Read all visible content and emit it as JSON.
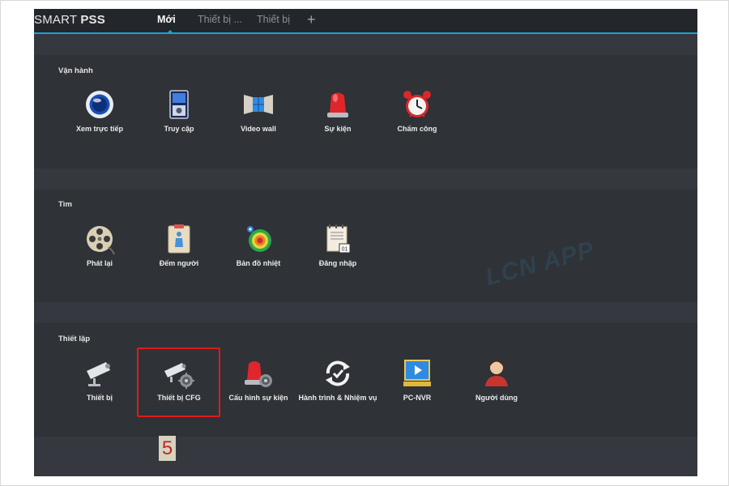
{
  "app": {
    "logo_prefix": "SMART ",
    "logo_bold": "PSS"
  },
  "tabs": [
    {
      "label": "Mới",
      "active": true
    },
    {
      "label": "Thiết bị ..."
    },
    {
      "label": "Thiết bị"
    }
  ],
  "add_tab_symbol": "+",
  "accent_color": "#17a3d8",
  "sections": {
    "operation": {
      "title": "Vận hành",
      "items": [
        {
          "label": "Xem trực tiếp",
          "icon": "live-view-icon"
        },
        {
          "label": "Truy cập",
          "icon": "access-control-icon"
        },
        {
          "label": "Video wall",
          "icon": "video-wall-icon"
        },
        {
          "label": "Sự kiện",
          "icon": "alarm-siren-icon"
        },
        {
          "label": "Chấm công",
          "icon": "alarm-clock-icon"
        }
      ]
    },
    "search": {
      "title": "Tìm",
      "items": [
        {
          "label": "Phát lại",
          "icon": "film-reel-icon"
        },
        {
          "label": "Đếm người",
          "icon": "people-count-icon"
        },
        {
          "label": "Bản đồ nhiệt",
          "icon": "heat-map-icon"
        },
        {
          "label": "Đăng nhập",
          "icon": "calendar-log-icon"
        }
      ]
    },
    "settings": {
      "title": "Thiết lập",
      "items": [
        {
          "label": "Thiết bị",
          "icon": "camera-icon"
        },
        {
          "label": "Thiết bị CFG",
          "icon": "camera-gear-icon"
        },
        {
          "label": "Cấu hình sự kiện",
          "icon": "siren-gear-icon"
        },
        {
          "label": "Hành trình & Nhiệm vụ",
          "icon": "tour-task-icon"
        },
        {
          "label": "PC-NVR",
          "icon": "pc-nvr-icon"
        },
        {
          "label": "Người dùng",
          "icon": "user-icon"
        }
      ]
    }
  },
  "annotation": {
    "step_number": "5"
  },
  "watermark": {
    "text": "LCN APP"
  }
}
